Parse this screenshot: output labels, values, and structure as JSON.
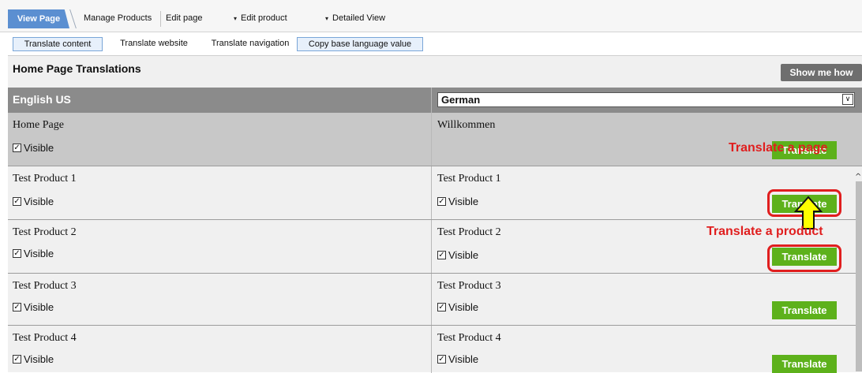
{
  "topnav": {
    "view_page": "View Page",
    "manage_products": "Manage Products",
    "edit_page": "Edit page",
    "edit_product": "Edit product",
    "detailed_view": "Detailed View",
    "dropdown_glyph": "▾"
  },
  "subnav": {
    "translate_content": "Translate content",
    "translate_website": "Translate website",
    "translate_navigation": "Translate navigation",
    "copy_base": "Copy base language value"
  },
  "main": {
    "title": "Home Page Translations",
    "show_me_how": "Show me how"
  },
  "table": {
    "source_lang": "English US",
    "target_lang": "German",
    "visible_label": "Visible",
    "translate_label": "Translate",
    "rows": [
      {
        "source": "Home Page",
        "target": "Willkommen"
      },
      {
        "source": "Test Product 1",
        "target": "Test Product 1"
      },
      {
        "source": "Test Product 2",
        "target": "Test Product 2"
      },
      {
        "source": "Test Product 3",
        "target": "Test Product 3"
      },
      {
        "source": "Test Product 4",
        "target": "Test Product 4"
      }
    ]
  },
  "annotations": {
    "translate_page": "Translate a page",
    "translate_product": "Translate a product"
  },
  "colors": {
    "accent_tab": "#5b8fd1",
    "translate_button": "#5db11b",
    "annotation_red": "#e01e1e",
    "arrow_yellow": "#ffff00",
    "header_gray": "#8b8b8b"
  },
  "icons": {
    "checkbox": "checkbox-checked-icon",
    "dropdown": "chevron-down-icon",
    "arrow": "up-arrow-annotation-icon"
  }
}
